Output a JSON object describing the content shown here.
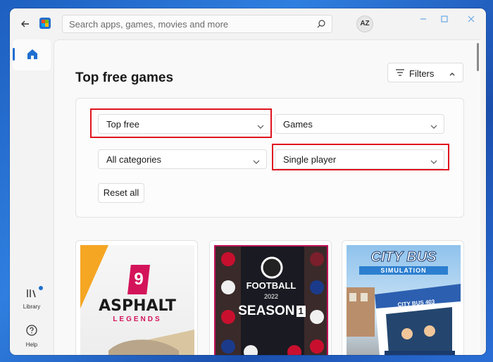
{
  "titlebar": {
    "search_placeholder": "Search apps, games, movies and more",
    "avatar_initials": "AZ"
  },
  "sidebar": {
    "library_label": "Library",
    "help_label": "Help"
  },
  "main": {
    "page_title": "Top free games",
    "filters_label": "Filters",
    "filters_expanded": true,
    "dropdowns": [
      {
        "id": "chart",
        "value": "Top free",
        "highlighted": true
      },
      {
        "id": "type",
        "value": "Games",
        "highlighted": false
      },
      {
        "id": "category",
        "value": "All categories",
        "highlighted": false
      },
      {
        "id": "players",
        "value": "Single player",
        "highlighted": true
      }
    ],
    "reset_label": "Reset all",
    "games": [
      {
        "title_art": "ASPHALT",
        "subtitle_art": "LEGENDS",
        "badge": "9"
      },
      {
        "title_art": "FOOTBALL",
        "year": "2022",
        "season": "SEASON",
        "season_num": "1"
      },
      {
        "title_art": "CITY BUS",
        "subtitle_art": "SIMULATION",
        "sign": "CITY BUS 403"
      }
    ]
  },
  "colors": {
    "accent": "#1f6fd0",
    "highlight_red": "#e0141e",
    "efootball_border": "#c0135a"
  }
}
